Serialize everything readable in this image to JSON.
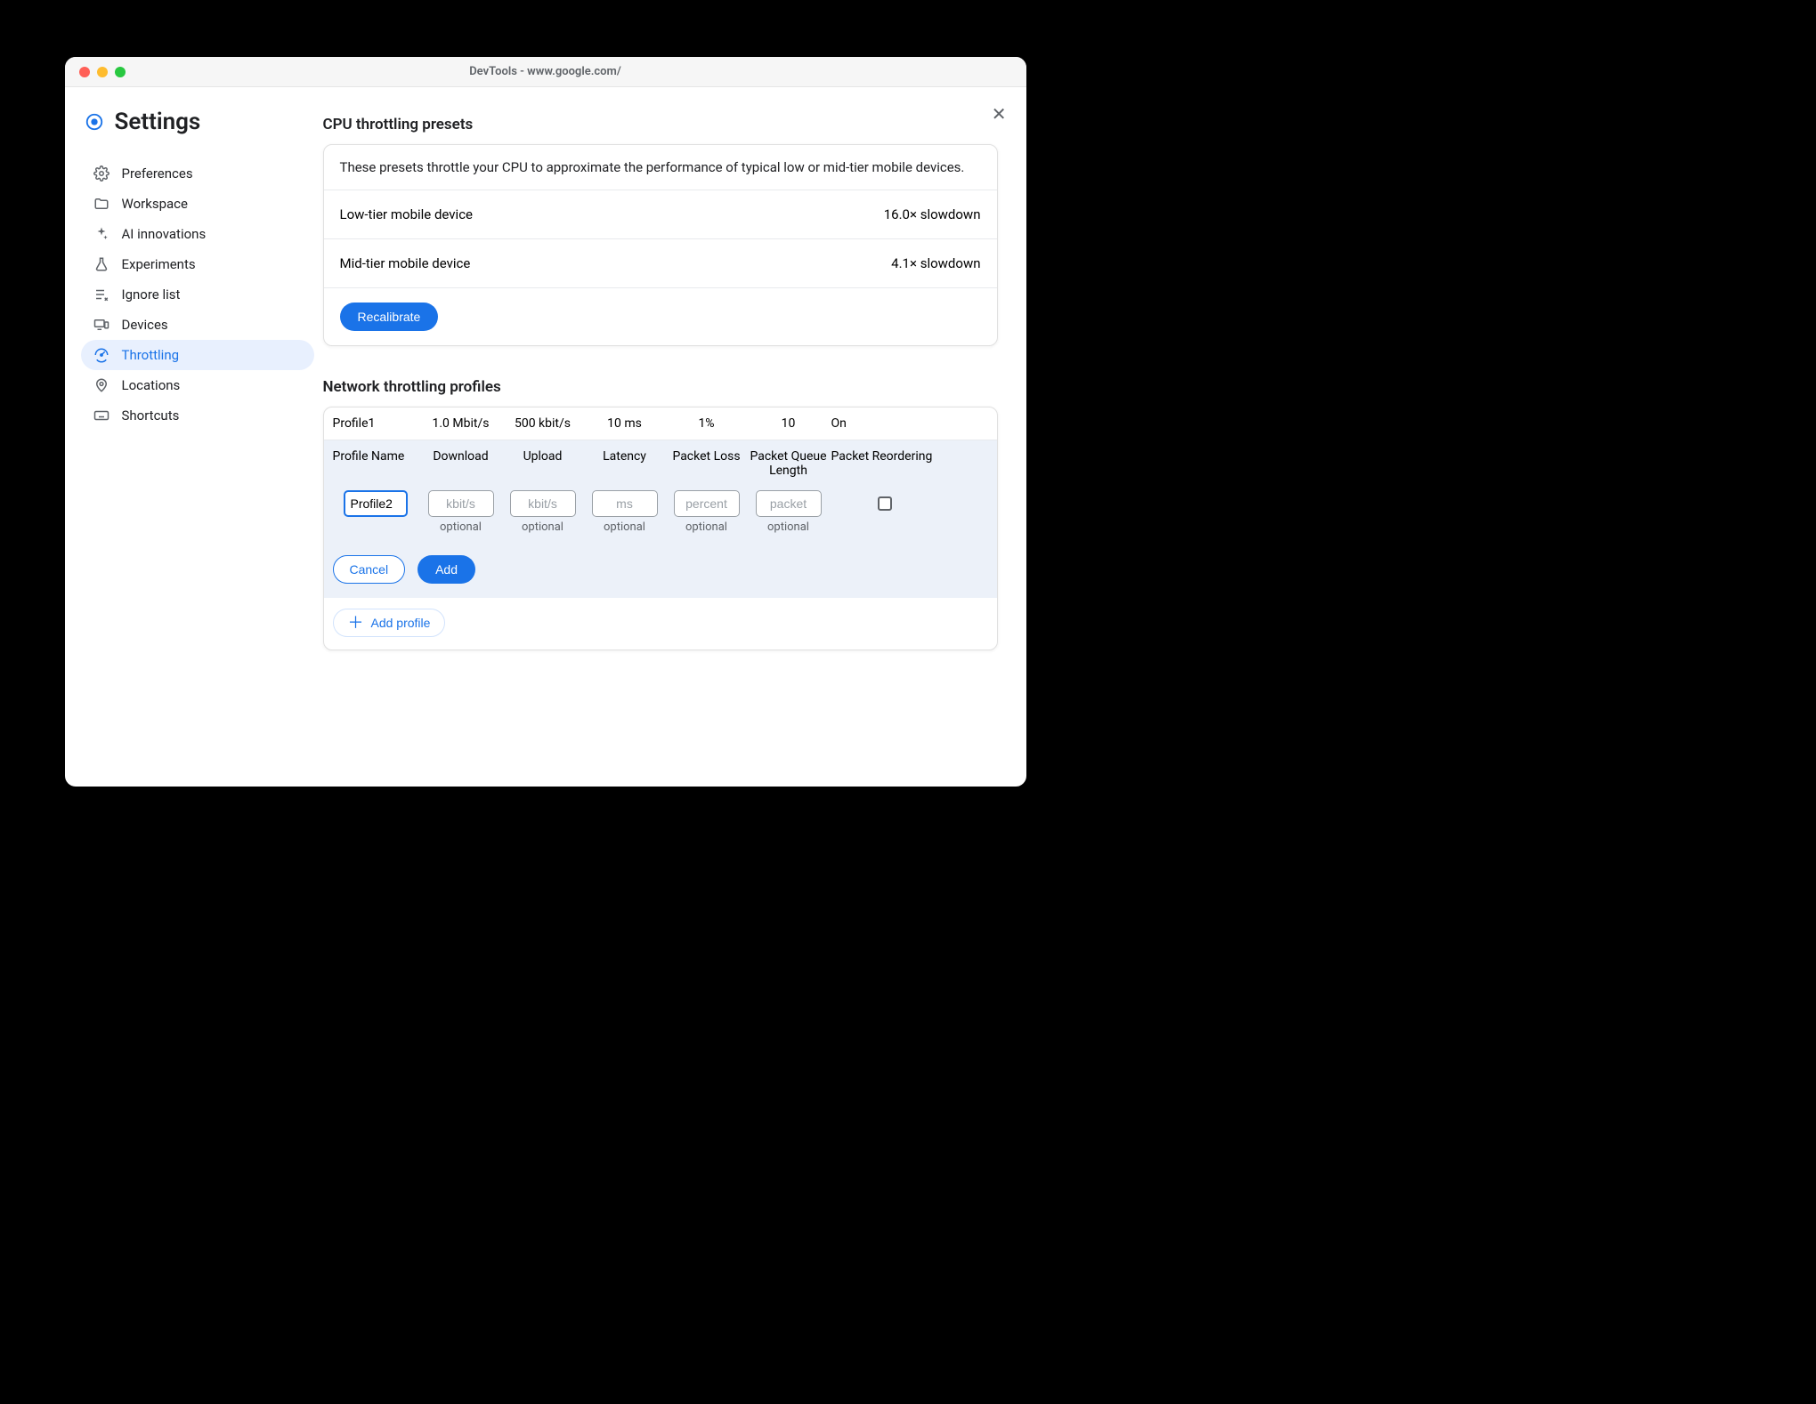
{
  "window": {
    "title": "DevTools - www.google.com/"
  },
  "settings": {
    "title": "Settings"
  },
  "nav": {
    "items": [
      {
        "label": "Preferences"
      },
      {
        "label": "Workspace"
      },
      {
        "label": "AI innovations"
      },
      {
        "label": "Experiments"
      },
      {
        "label": "Ignore list"
      },
      {
        "label": "Devices"
      },
      {
        "label": "Throttling"
      },
      {
        "label": "Locations"
      },
      {
        "label": "Shortcuts"
      }
    ]
  },
  "cpu": {
    "section_title": "CPU throttling presets",
    "description": "These presets throttle your CPU to approximate the performance of typical low or mid-tier mobile devices.",
    "presets": [
      {
        "label": "Low-tier mobile device",
        "value": "16.0× slowdown"
      },
      {
        "label": "Mid-tier mobile device",
        "value": "4.1× slowdown"
      }
    ],
    "recalibrate_label": "Recalibrate"
  },
  "network": {
    "section_title": "Network throttling profiles",
    "columns": {
      "name": "Profile Name",
      "download": "Download",
      "upload": "Upload",
      "latency": "Latency",
      "loss": "Packet Loss",
      "queue": "Packet Queue Length",
      "reorder": "Packet Reordering"
    },
    "existing": {
      "name": "Profile1",
      "download": "1.0 Mbit/s",
      "upload": "500 kbit/s",
      "latency": "10 ms",
      "loss": "1%",
      "queue": "10",
      "reorder": "On"
    },
    "editor": {
      "name_value": "Profile2",
      "download_placeholder": "kbit/s",
      "upload_placeholder": "kbit/s",
      "latency_placeholder": "ms",
      "loss_placeholder": "percent",
      "queue_placeholder": "packet",
      "optional_label": "optional",
      "cancel_label": "Cancel",
      "add_label": "Add"
    },
    "add_profile_label": "Add profile"
  }
}
